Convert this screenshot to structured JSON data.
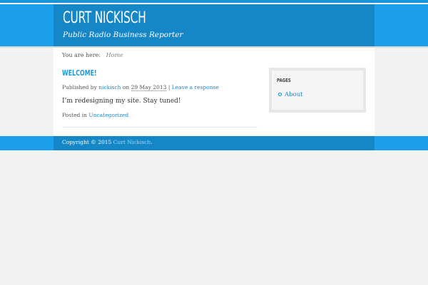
{
  "site": {
    "title": "CURT NICKISCH",
    "description": "Public Radio Business Reporter"
  },
  "breadcrumb": {
    "prefix": "You are here:",
    "current": "Home"
  },
  "post": {
    "title": "Welcome!",
    "meta_published_by": "Published by",
    "meta_author": "nickisch",
    "meta_on": "on",
    "meta_date": "29 May 2013",
    "meta_separator": "|",
    "meta_comments": "Leave a response",
    "body": "I’m redesigning my site.  Stay tuned!",
    "posted_in": "Posted in",
    "category": "Uncategorized"
  },
  "sidebar": {
    "widget_title": "PAGES",
    "items": [
      {
        "label": "About"
      }
    ]
  },
  "footer": {
    "copyright": "Copyright © 2015",
    "owner": "Curt Nickisch",
    "period": "."
  },
  "colors": {
    "header_band": "#1b9fea",
    "header_inner": "#1586c6",
    "link": "#1a87c9",
    "title_accent": "#1a9ad6",
    "background": "#f2f2f2"
  }
}
